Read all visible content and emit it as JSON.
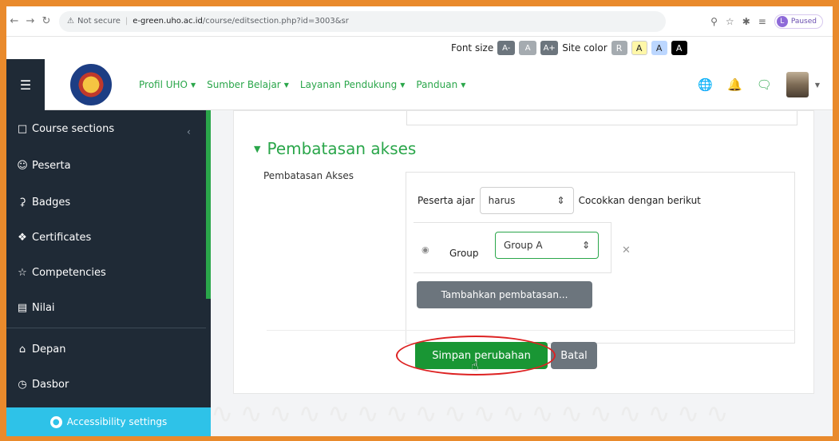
{
  "browser": {
    "back_icon": "arrow-left-icon",
    "forward_icon": "arrow-right-icon",
    "reload_icon": "reload-icon",
    "security_label": "Not secure",
    "url_host": "e-green.uho.ac.id",
    "url_path": "/course/editsection.php?id=3003&sr",
    "profile_status": "Paused",
    "profile_initial": "L"
  },
  "a11y_toolbar": {
    "font_size_label": "Font size",
    "font_buttons": [
      "A-",
      "A",
      "A+"
    ],
    "site_color_label": "Site color",
    "color_buttons": [
      "R",
      "A",
      "A",
      "A"
    ],
    "colors": {
      "font_btn": "#6c757d",
      "reset": "#6c757d",
      "yellow": "#fff7a8",
      "blue": "#bcd7ff",
      "black": "#000000"
    }
  },
  "navbar": {
    "menu": [
      {
        "label": "Profil UHO"
      },
      {
        "label": "Sumber Belajar"
      },
      {
        "label": "Layanan Pendukung"
      },
      {
        "label": "Panduan"
      }
    ],
    "accent": "#2aa64a"
  },
  "sidebar": {
    "items": [
      {
        "label": "Course sections",
        "icon": "folder-icon"
      },
      {
        "label": "Peserta",
        "icon": "users-icon"
      },
      {
        "label": "Badges",
        "icon": "badge-icon"
      },
      {
        "label": "Certificates",
        "icon": "certificate-icon"
      },
      {
        "label": "Competencies",
        "icon": "star-icon"
      },
      {
        "label": "Nilai",
        "icon": "grades-icon"
      },
      {
        "label": "Depan",
        "icon": "home-icon"
      },
      {
        "label": "Dasbor",
        "icon": "dashboard-icon"
      }
    ],
    "accessibility_settings": "Accessibility settings"
  },
  "content": {
    "section_title": "Pembatasan akses",
    "field_label": "Pembatasan Akses",
    "peserta_label": "Peserta ajar",
    "peserta_select_value": "harus",
    "match_text": "Cocokkan dengan berikut",
    "group_label": "Group",
    "group_select_value": "Group A",
    "add_restriction_label": "Tambahkan pembatasan...",
    "save_label": "Simpan perubahan",
    "cancel_label": "Batal"
  }
}
